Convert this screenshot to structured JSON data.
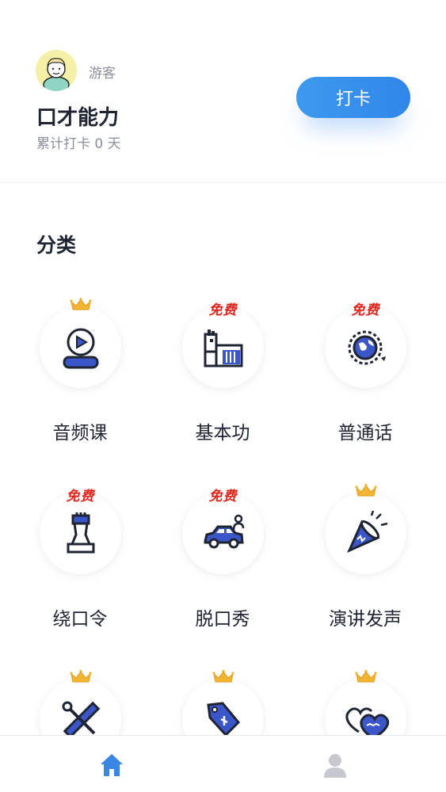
{
  "profile": {
    "username": "游客",
    "app_title": "口才能力",
    "checkin_count": "累计打卡 0 天",
    "checkin_button": "打卡"
  },
  "section": {
    "title": "分类"
  },
  "categories": [
    {
      "label": "音频课",
      "badge": "crown",
      "icon": "audio-person-icon"
    },
    {
      "label": "基本功",
      "badge": "免费",
      "icon": "factory-icon"
    },
    {
      "label": "普通话",
      "badge": "免费",
      "icon": "globe-icon"
    },
    {
      "label": "绕口令",
      "badge": "免费",
      "icon": "chess-piece-icon"
    },
    {
      "label": "脱口秀",
      "badge": "免费",
      "icon": "car-icon"
    },
    {
      "label": "演讲发声",
      "badge": "crown",
      "icon": "party-popper-icon"
    },
    {
      "label": "",
      "badge": "crown",
      "icon": "tools-icon"
    },
    {
      "label": "",
      "badge": "crown",
      "icon": "tag-icon"
    },
    {
      "label": "",
      "badge": "crown",
      "icon": "hearts-icon"
    }
  ],
  "nav": {
    "items": [
      {
        "name": "home",
        "icon": "home-icon",
        "active": true
      },
      {
        "name": "profile",
        "icon": "person-icon",
        "active": false
      }
    ],
    "active_color": "#3b86e4",
    "inactive_color": "#c6c8cf"
  },
  "colors": {
    "accent": "#3b86e4",
    "icon_blue": "#3a56c9",
    "free_red": "#e1251b",
    "crown_gold": "#f1b531"
  }
}
